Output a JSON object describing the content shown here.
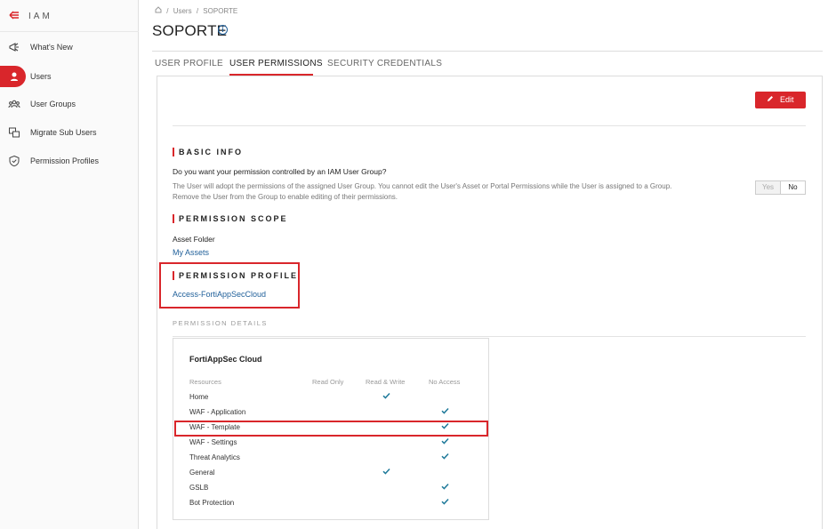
{
  "sidebar": {
    "title": "IAM",
    "items": [
      {
        "label": "What's New",
        "icon": "megaphone-icon"
      },
      {
        "label": "Users",
        "icon": "user-icon",
        "active": true
      },
      {
        "label": "User Groups",
        "icon": "user-group-icon"
      },
      {
        "label": "Migrate Sub Users",
        "icon": "migrate-icon"
      },
      {
        "label": "Permission Profiles",
        "icon": "shield-icon"
      }
    ]
  },
  "breadcrumb": {
    "home_icon": "home-icon",
    "sep": "/",
    "items": [
      "Users",
      "SOPORTE"
    ]
  },
  "page": {
    "title": "SOPORTE"
  },
  "tabs": [
    {
      "label": "USER PROFILE"
    },
    {
      "label": "USER PERMISSIONS",
      "active": true
    },
    {
      "label": "SECURITY CREDENTIALS"
    }
  ],
  "actions": {
    "edit_label": "Edit"
  },
  "basic_info": {
    "title": "BASIC INFO",
    "question": "Do you want your permission controlled by an IAM User Group?",
    "description": "The User will adopt the permissions of the assigned User Group. You cannot edit the User's Asset or Portal Permissions while the User is assigned to a Group. Remove the User from the Group to enable editing of their permissions.",
    "yes_label": "Yes",
    "no_label": "No",
    "selected": "No"
  },
  "permission_scope": {
    "title": "PERMISSION SCOPE",
    "asset_folder_label": "Asset Folder",
    "asset_folder_value": "My Assets"
  },
  "permission_profile": {
    "title": "PERMISSION PROFILE",
    "value": "Access-FortiAppSecCloud"
  },
  "permission_details": {
    "title": "PERMISSION DETAILS",
    "card_title": "FortiAppSec Cloud",
    "columns": [
      "Resources",
      "Read Only",
      "Read & Write",
      "No Access"
    ],
    "rows": [
      {
        "resource": "Home",
        "access": "Read & Write"
      },
      {
        "resource": "WAF - Application",
        "access": "No Access"
      },
      {
        "resource": "WAF - Template",
        "access": "No Access"
      },
      {
        "resource": "WAF - Settings",
        "access": "No Access"
      },
      {
        "resource": "Threat Analytics",
        "access": "No Access"
      },
      {
        "resource": "General",
        "access": "Read & Write"
      },
      {
        "resource": "GSLB",
        "access": "No Access"
      },
      {
        "resource": "Bot Protection",
        "access": "No Access"
      }
    ]
  },
  "colors": {
    "accent": "#d9262b",
    "link": "#1f5f99",
    "check": "#1f7a9a"
  }
}
